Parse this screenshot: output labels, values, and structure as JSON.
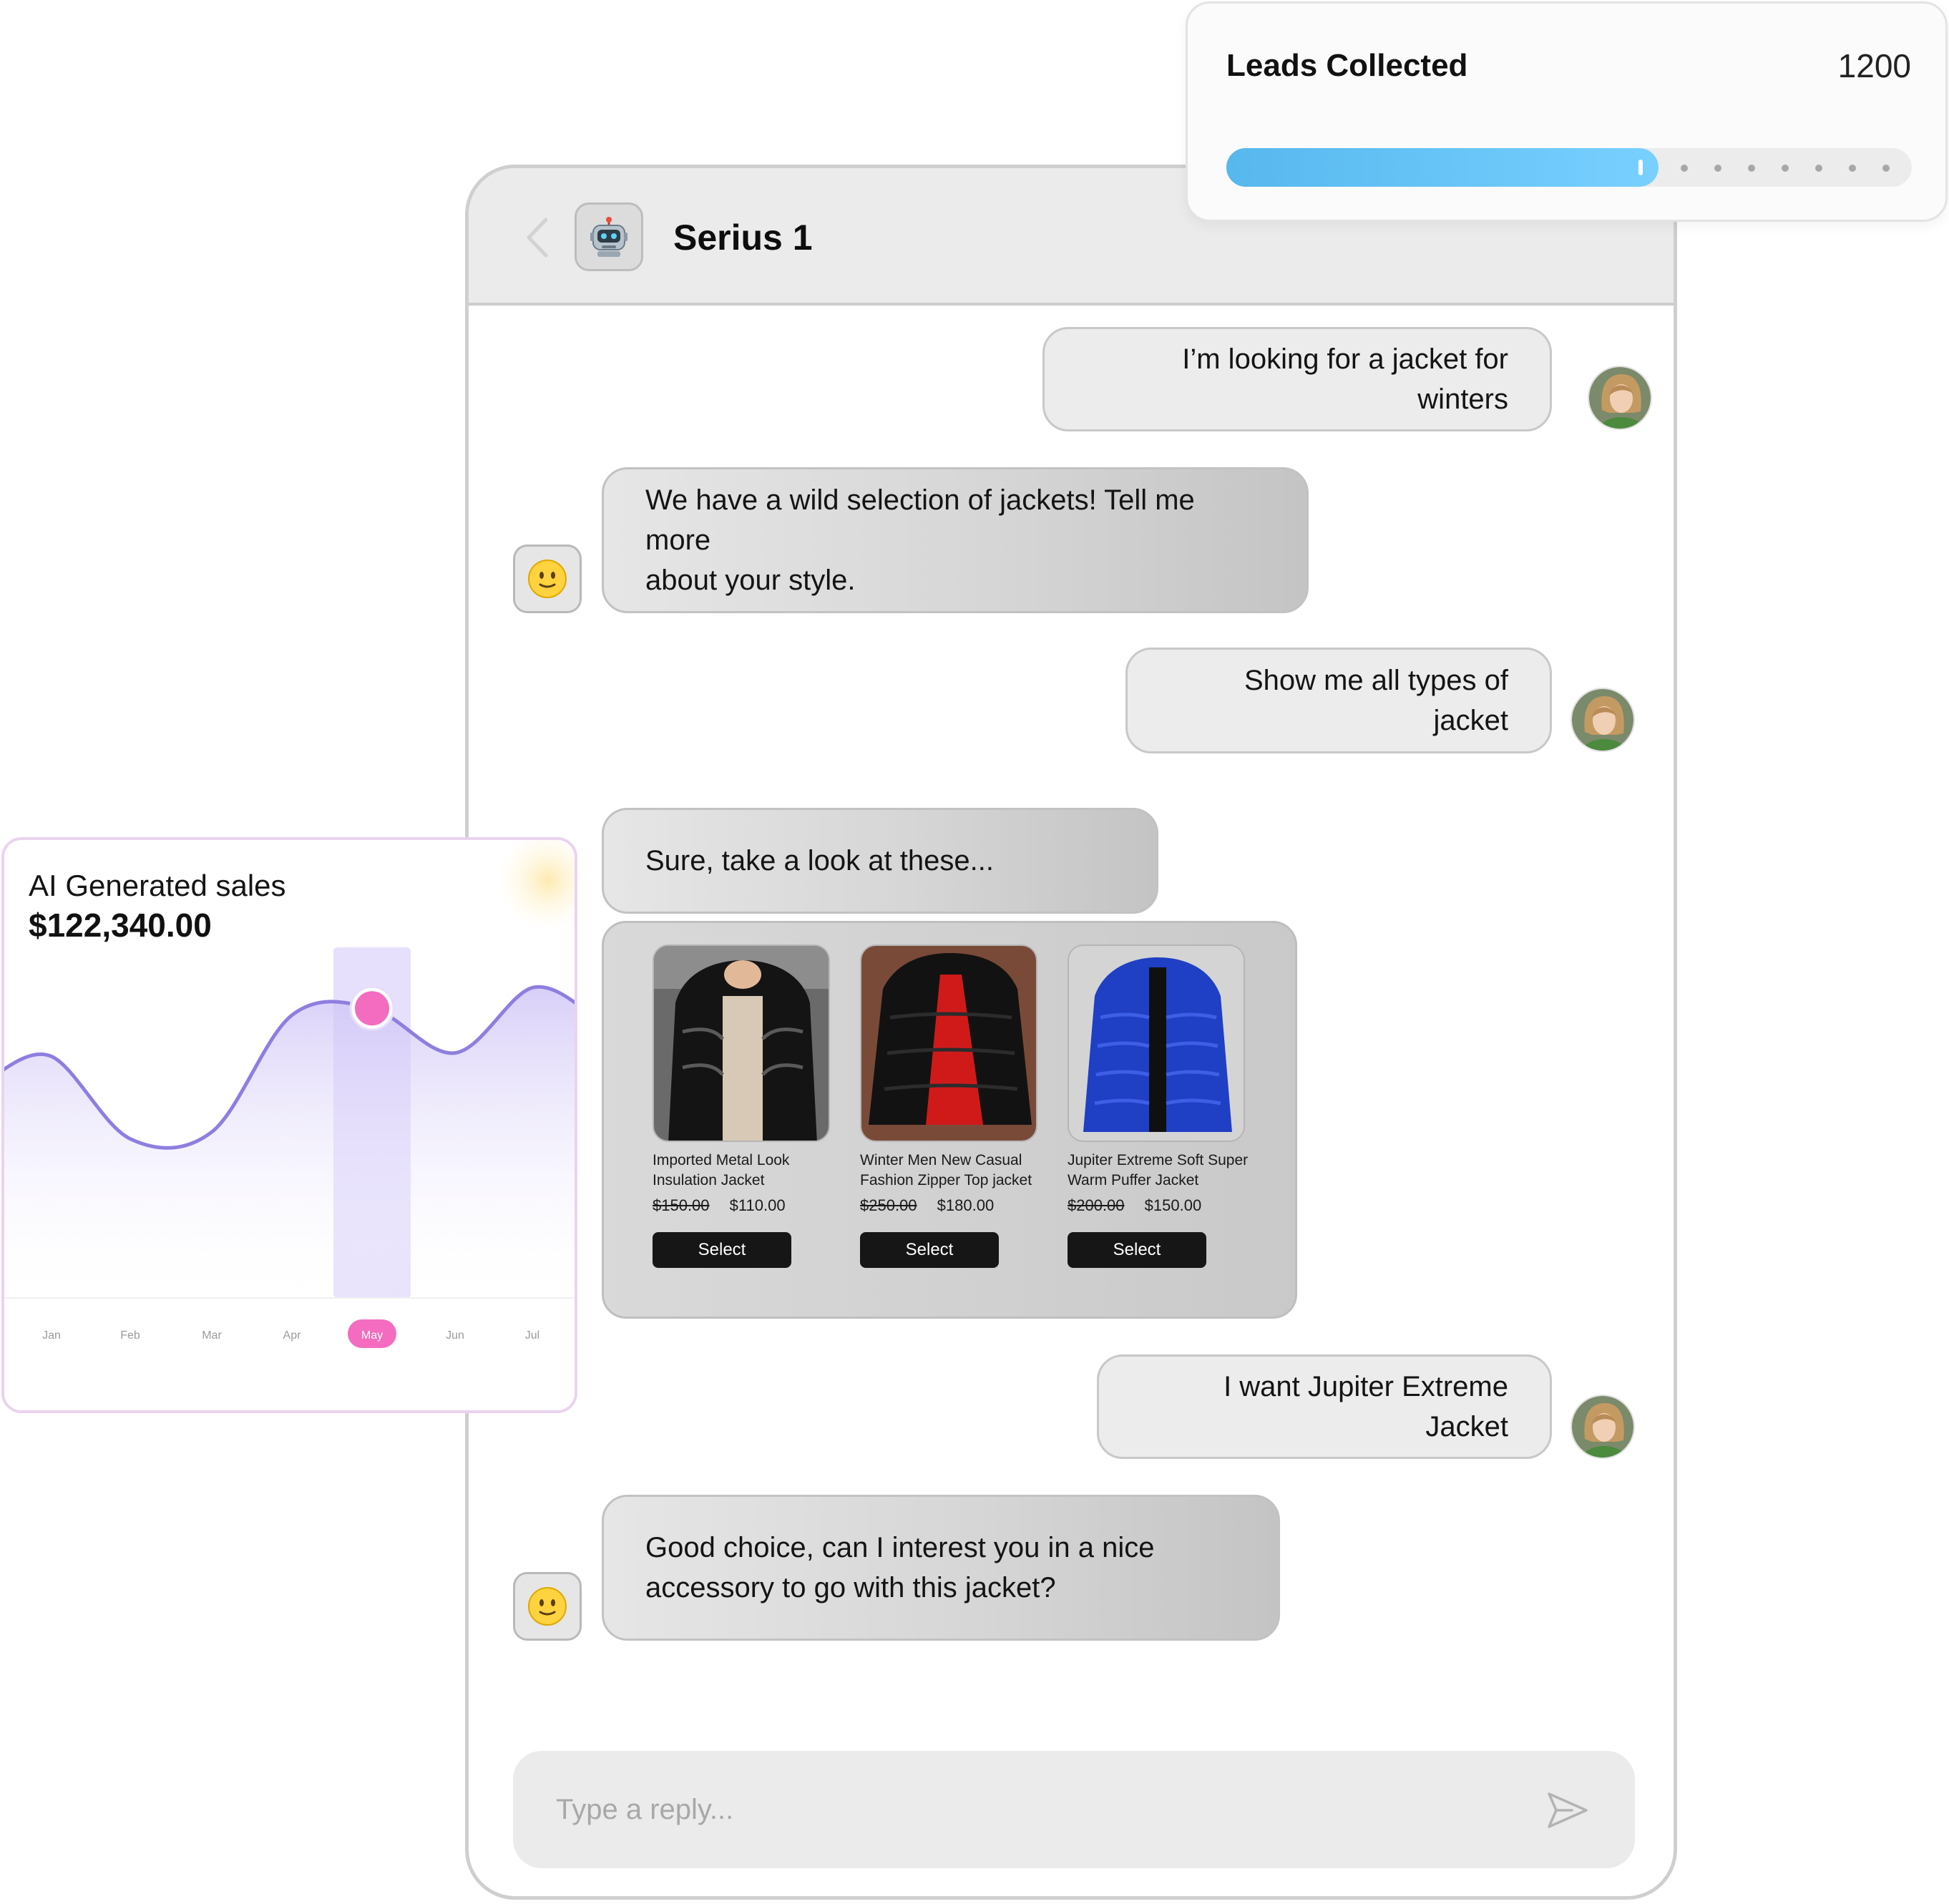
{
  "leads": {
    "title": "Leads Collected",
    "count": "1200",
    "progress_fraction": 0.63,
    "remaining_dots": 7,
    "colors": {
      "fill": "#66c2f4",
      "track": "#ececec"
    }
  },
  "chat": {
    "title": "Serius 1",
    "bot_icon": "robot-icon",
    "messages": [
      {
        "role": "user",
        "text": "I’m looking for a jacket for winters"
      },
      {
        "role": "bot",
        "line1": "We have a wild selection of jackets! Tell me more",
        "line2": "about your style."
      },
      {
        "role": "user",
        "text": "Show me all types of jacket"
      },
      {
        "role": "bot",
        "text": "Sure, take a look at these..."
      },
      {
        "role": "user",
        "text": "I want Jupiter Extreme Jacket"
      },
      {
        "role": "bot",
        "line1": "Good choice, can I interest you in a nice",
        "line2": "accessory to go with this jacket?"
      }
    ],
    "products": [
      {
        "name_line1": "Imported Metal Look",
        "name_line2": "Insulation Jacket",
        "old_price": "$150.00",
        "price": "$110.00",
        "button": "Select",
        "image": "black-glossy-puffer-jacket"
      },
      {
        "name_line1": "Winter Men New Casual",
        "name_line2": "Fashion Zipper Top jacket",
        "old_price": "$250.00",
        "price": "$180.00",
        "button": "Select",
        "image": "black-red-lined-puffer-jacket"
      },
      {
        "name_line1": "Jupiter Extreme Soft Super",
        "name_line2": "Warm Puffer Jacket",
        "old_price": "$200.00",
        "price": "$150.00",
        "button": "Select",
        "image": "blue-puffer-jacket"
      }
    ],
    "reply": {
      "placeholder": "Type a reply..."
    }
  },
  "sales": {
    "title": "AI Generated sales",
    "value": "$122,340.00",
    "chart_data": {
      "type": "area",
      "categories": [
        "Jan",
        "Feb",
        "Mar",
        "Apr",
        "May",
        "Jun",
        "Jul"
      ],
      "highlight": "May",
      "series": [
        {
          "values": [
            0.62,
            0.38,
            0.4,
            0.74,
            0.76,
            0.63,
            0.82
          ]
        }
      ],
      "ylim": [
        0,
        1
      ],
      "grid": false,
      "colors": {
        "line": "#8f7ee0",
        "highlight": "#f36cbf",
        "band": "#ddd6fb"
      }
    }
  }
}
